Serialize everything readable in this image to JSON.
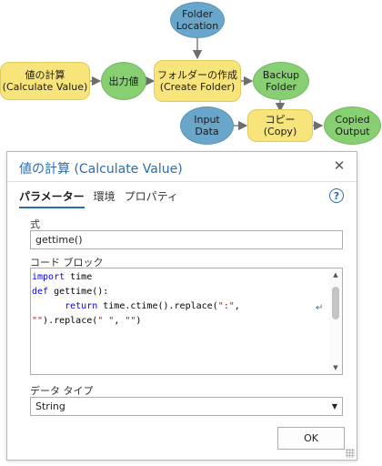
{
  "diagram": {
    "folder_location": "Folder\nLocation",
    "calc_value": "値の計算\n(Calculate Value)",
    "output_value": "出力値",
    "create_folder": "フォルダーの作成\n(Create Folder)",
    "backup_folder": "Backup\nFolder",
    "input_data": "Input\nData",
    "copy": "コピー (Copy)",
    "copied_output": "Copied\nOutput"
  },
  "dialog": {
    "title": "値の計算 (Calculate Value)",
    "close_glyph": "✕",
    "tabs": [
      "パラメーター",
      "環境",
      "プロパティ"
    ],
    "help_glyph": "?",
    "expression_label": "式",
    "expression_value": "gettime()",
    "code_block_label": "コード ブロック",
    "code": {
      "line1_kw": "import",
      "line1_rest": " time",
      "line2_kw": "def",
      "line2_rest": " gettime():",
      "line3_indent": "      ",
      "line3_kw": "return",
      "line3_rest": " time.ctime().replace(",
      "line3_str": "\":\"",
      "line3_end": ",",
      "line4_str1": "\"\"",
      "line4_mid": ").replace(",
      "line4_str2": "\" \"",
      "line4_sep": ", ",
      "line4_str3": "\"\"",
      "line4_end": ")"
    },
    "wrap_glyph": "↵",
    "data_type_label": "データ タイプ",
    "data_type_value": "String",
    "ok_label": "OK"
  },
  "colors": {
    "accent": "#2b6cb0",
    "blue_node": "#6aa6c9",
    "green_node": "#88cf74",
    "yellow_node": "#f7e47a"
  }
}
